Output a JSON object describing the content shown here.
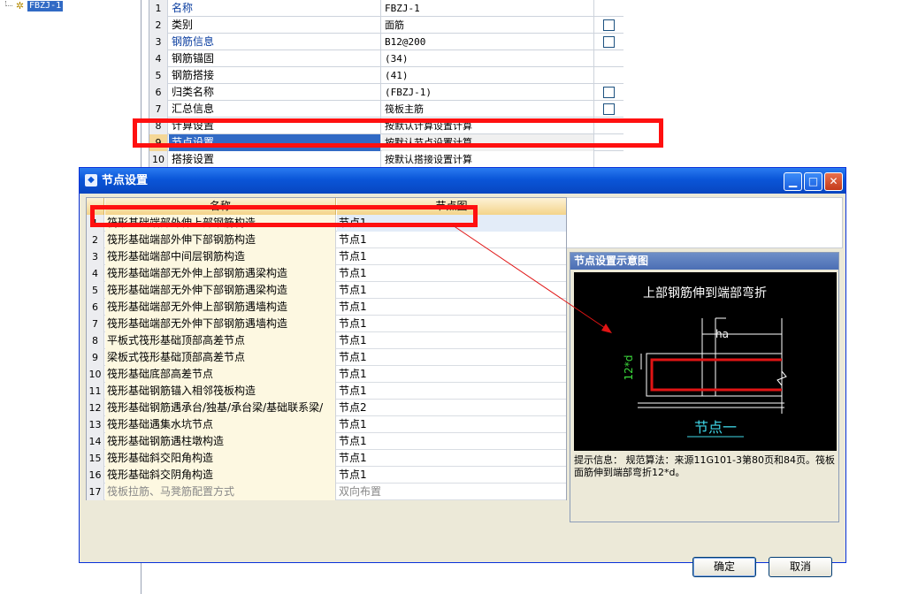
{
  "tree": {
    "label": "FBZJ-1"
  },
  "properties": [
    {
      "num": "1",
      "name": "名称",
      "value": "FBZJ-1",
      "name_blue": true,
      "checkbox": false
    },
    {
      "num": "2",
      "name": "类别",
      "value": "面筋",
      "name_blue": false,
      "checkbox": true
    },
    {
      "num": "3",
      "name": "钢筋信息",
      "value": "B12@200",
      "name_blue": true,
      "checkbox": true
    },
    {
      "num": "4",
      "name": "钢筋锚固",
      "value": "(34)",
      "name_blue": false,
      "checkbox": false
    },
    {
      "num": "5",
      "name": "钢筋搭接",
      "value": "(41)",
      "name_blue": false,
      "checkbox": false
    },
    {
      "num": "6",
      "name": "归类名称",
      "value": "(FBZJ-1)",
      "name_blue": false,
      "checkbox": true
    },
    {
      "num": "7",
      "name": "汇总信息",
      "value": "筏板主筋",
      "name_blue": false,
      "checkbox": true
    },
    {
      "num": "8",
      "name": "计算设置",
      "value": "按默认计算设置计算",
      "name_blue": false,
      "checkbox": false
    },
    {
      "num": "9",
      "name": "节点设置",
      "value": "按默认节点设置计算",
      "name_blue": false,
      "checkbox": false,
      "selected": true
    },
    {
      "num": "10",
      "name": "搭接设置",
      "value": "按默认搭接设置计算",
      "name_blue": false,
      "checkbox": false
    }
  ],
  "dialog": {
    "title": "节点设置",
    "header_name": "名称",
    "header_node": "节点图",
    "rows": [
      {
        "num": "1",
        "name": "筏形基础端部外伸上部钢筋构造",
        "node": "节点1"
      },
      {
        "num": "2",
        "name": "筏形基础端部外伸下部钢筋构造",
        "node": "节点1"
      },
      {
        "num": "3",
        "name": "筏形基础端部中间层钢筋构造",
        "node": "节点1"
      },
      {
        "num": "4",
        "name": "筏形基础端部无外伸上部钢筋遇梁构造",
        "node": "节点1"
      },
      {
        "num": "5",
        "name": "筏形基础端部无外伸下部钢筋遇梁构造",
        "node": "节点1"
      },
      {
        "num": "6",
        "name": "筏形基础端部无外伸上部钢筋遇墙构造",
        "node": "节点1"
      },
      {
        "num": "7",
        "name": "筏形基础端部无外伸下部钢筋遇墙构造",
        "node": "节点1"
      },
      {
        "num": "8",
        "name": "平板式筏形基础顶部高差节点",
        "node": "节点1"
      },
      {
        "num": "9",
        "name": "梁板式筏形基础顶部高差节点",
        "node": "节点1"
      },
      {
        "num": "10",
        "name": "筏形基础底部高差节点",
        "node": "节点1"
      },
      {
        "num": "11",
        "name": "筏形基础钢筋锚入相邻筏板构造",
        "node": "节点1"
      },
      {
        "num": "12",
        "name": "筏形基础钢筋遇承台/独基/承台梁/基础联系梁/",
        "node": "节点2"
      },
      {
        "num": "13",
        "name": "筏形基础遇集水坑节点",
        "node": "节点1"
      },
      {
        "num": "14",
        "name": "筏形基础钢筋遇柱墩构造",
        "node": "节点1"
      },
      {
        "num": "15",
        "name": "筏形基础斜交阳角构造",
        "node": "节点1"
      },
      {
        "num": "16",
        "name": "筏形基础斜交阴角构造",
        "node": "节点1"
      },
      {
        "num": "17",
        "name": "筏板拉筋、马凳筋配置方式",
        "node": "双向布置",
        "dim": true
      }
    ],
    "preview": {
      "title": "节点设置示意图",
      "diagram_title": "上部钢筋伸到端部弯折",
      "dim_ha": "ha",
      "dim_12d": "12*d",
      "node_label": "节点一",
      "hint": "提示信息： 规范算法：来源11G101-3第80页和84页。筏板面筋伸到端部弯折12*d。"
    },
    "ok_label": "确定",
    "cancel_label": "取消"
  },
  "colors": {
    "highlight": "#ff1010",
    "selection": "#316ac5",
    "title_bar": "#0a55d8"
  }
}
